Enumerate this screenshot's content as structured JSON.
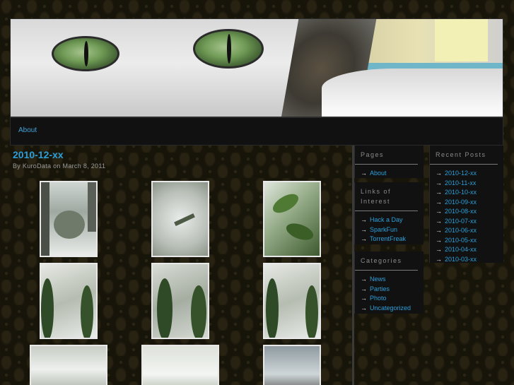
{
  "nav": {
    "items": [
      {
        "label": "About"
      }
    ]
  },
  "post": {
    "title": "2010-12-xx",
    "meta": "By KuroData on March 8, 2011"
  },
  "sidebar": {
    "pages": {
      "heading": "Pages",
      "items": [
        "About"
      ]
    },
    "links": {
      "heading": "Links of Interest",
      "items": [
        "Hack a Day",
        "SparkFun",
        "TorrentFreak"
      ]
    },
    "categories": {
      "heading": "Categories",
      "items": [
        "News",
        "Parties",
        "Photo",
        "Uncategorized"
      ]
    },
    "recent": {
      "heading": "Recent Posts",
      "items": [
        "2010-12-xx",
        "2010-11-xx",
        "2010-10-xx",
        "2010-09-xx",
        "2010-08-xx",
        "2010-07-xx",
        "2010-06-xx",
        "2010-05-xx",
        "2010-04-xx",
        "2010-03-xx"
      ]
    }
  },
  "icons": {
    "list_bullet": "→"
  },
  "colors": {
    "link": "#2b9fd9",
    "background": "#17140a",
    "panel": "#111111"
  }
}
